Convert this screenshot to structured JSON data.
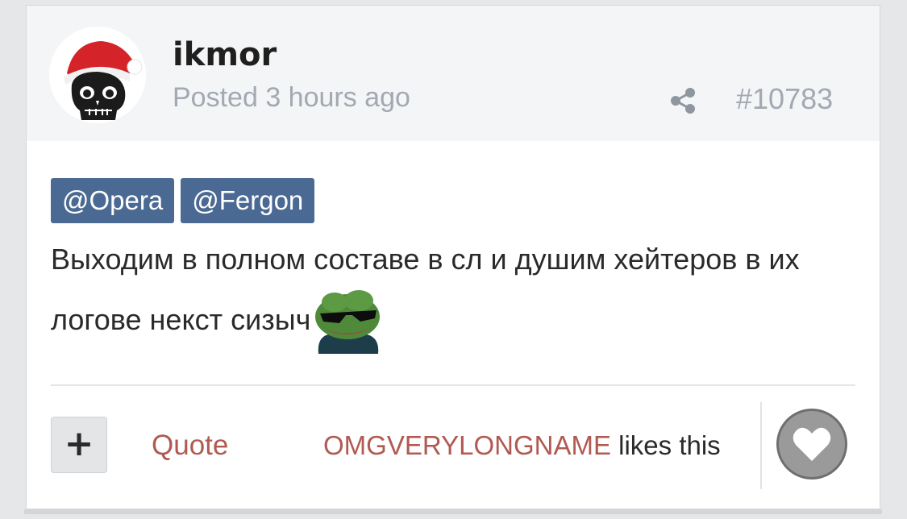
{
  "post": {
    "username": "ikmor",
    "posted_label": "Posted",
    "posted_time": "3 hours ago",
    "post_number": "#10783",
    "share_icon": "share-icon",
    "avatar": "skull-santa-hat-avatar",
    "mentions": [
      "@Opera",
      "@Fergon"
    ],
    "body": "Выходим в полном составе в сл и душим хейтеров в их логове некст сизыч",
    "emoji": "pepe-sunglasses-emoji"
  },
  "actions": {
    "plus_label": "+",
    "quote_label": "Quote",
    "liker_name": "OMGVERYLONGNAME",
    "likes_suffix": "likes this",
    "like_icon": "heart-icon"
  },
  "colors": {
    "mention_bg": "#4b6a93",
    "link_red": "#b05a52",
    "muted_gray": "#a3a9b2",
    "header_bg": "#f4f5f6"
  }
}
